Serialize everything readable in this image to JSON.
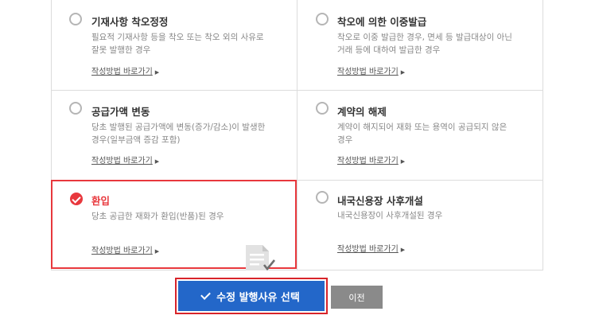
{
  "options": [
    {
      "title": "기재사항 착오정정",
      "desc_line1": "필요적 기재사항 등을 착오 또는 착오 외의 사유로",
      "desc_line2": "잘못 발행한 경우",
      "link": "작성방법 바로가기",
      "selected": false
    },
    {
      "title": "착오에 의한 이중발급",
      "desc_line1": "착오로 이중 발급한 경우, 면세 등 발급대상이 아닌",
      "desc_line2": "거래 등에 대하여 발급한 경우",
      "link": "작성방법 바로가기",
      "selected": false
    },
    {
      "title": "공급가액 변동",
      "desc_line1": "당초 발행된 공급가액에 변동(증가/감소)이 발생한",
      "desc_line2": "경우(일부금액 증감 포함)",
      "link": "작성방법 바로가기",
      "selected": false
    },
    {
      "title": "계약의 해제",
      "desc_line1": "계약이 해지되어 재화 또는 용역이 공급되지 않은",
      "desc_line2": "경우",
      "link": "작성방법 바로가기",
      "selected": false
    },
    {
      "title": "환입",
      "desc_line1": "당초 공급한 재화가 환입(반품)된 경우",
      "desc_line2": "",
      "link": "작성방법 바로가기",
      "selected": true
    },
    {
      "title": "내국신용장 사후개설",
      "desc_line1": "내국신용장이 사후개설된 경우",
      "desc_line2": "",
      "link": "작성방법 바로가기",
      "selected": false
    }
  ],
  "buttons": {
    "select_label": "수정 발행사유 선택",
    "prev_label": "이전"
  },
  "colors": {
    "accent_red": "#e8383d",
    "primary_blue": "#2367c9",
    "secondary_gray": "#8a8a8a"
  }
}
